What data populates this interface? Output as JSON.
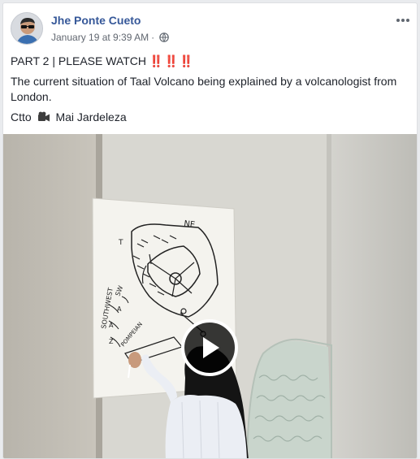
{
  "post": {
    "author": "Jhe Ponte Cueto",
    "timestamp": "January 19 at 9:39 AM",
    "separator": "·",
    "privacy_icon": "globe-icon",
    "more_icon": "more-options-icon",
    "lines": {
      "line1": "PART 2 | PLEASE WATCH",
      "line1_emoji": "‼️‼️‼️",
      "line2": "The current situation of Taal Volcano being explained by a volcanologist from London.",
      "line3_prefix": "Ctto",
      "line3_icon": "video-camera-icon",
      "line3_suffix": "Mai Jardeleza"
    }
  },
  "video": {
    "play_icon": "play-icon",
    "whiteboard_labels": {
      "ne": "NE",
      "southwest": "SOUTHWEST",
      "sw": "SW",
      "a1": "A",
      "a2": "A",
      "z": "Z",
      "pomp": "POMPEIAN",
      "t": "T"
    }
  },
  "colors": {
    "link": "#365899",
    "text": "#1d2129",
    "meta": "#616770",
    "page_bg": "#e9ebee"
  }
}
